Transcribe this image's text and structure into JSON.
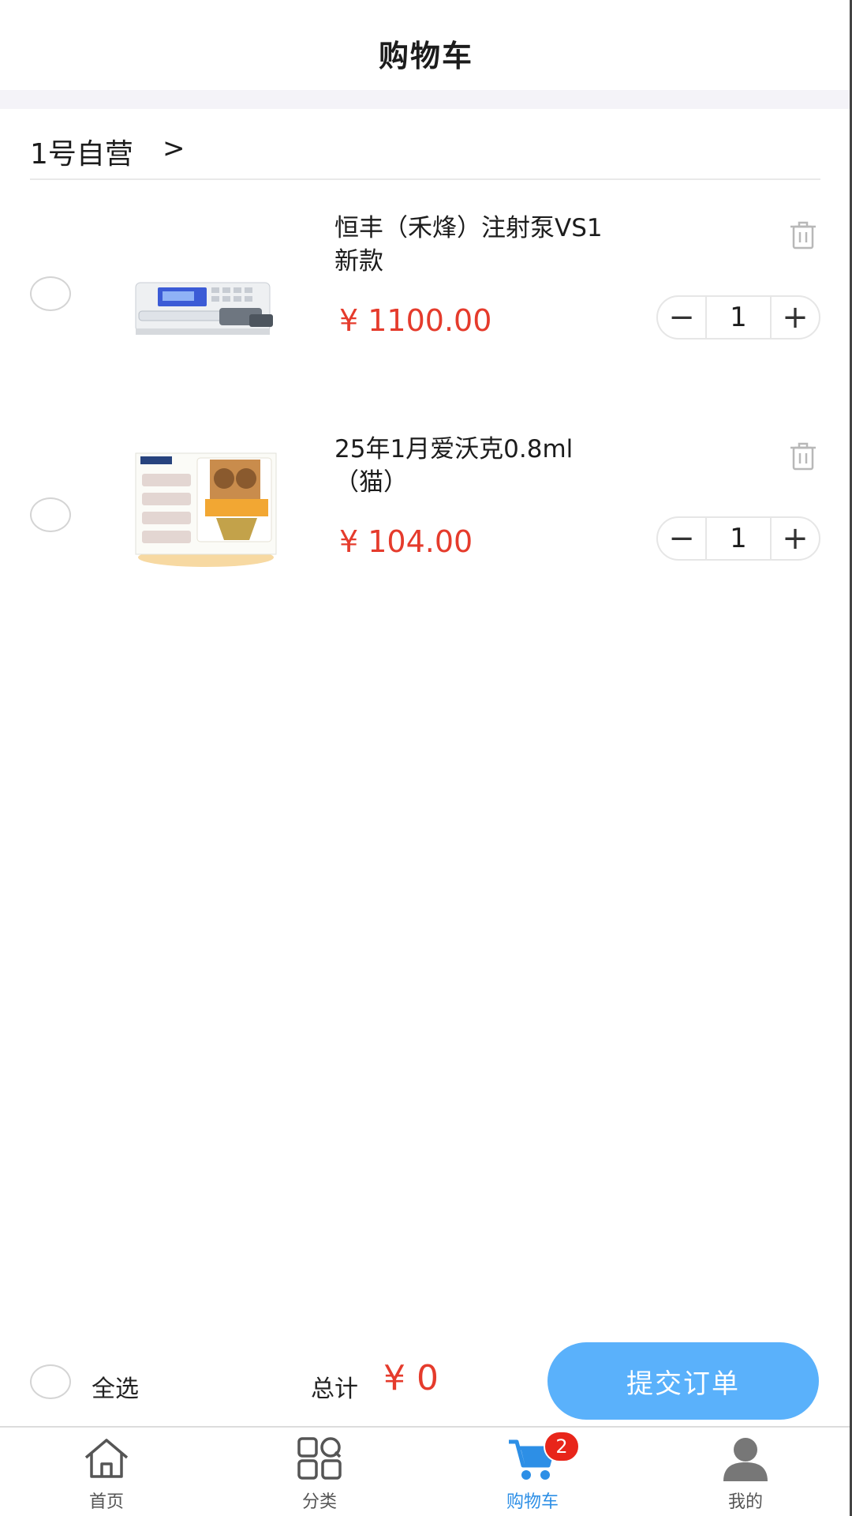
{
  "header": {
    "title": "购物车"
  },
  "store": {
    "name": "1号自营",
    "chevron": ">"
  },
  "cart_items": [
    {
      "name_line1": "恒丰（禾烽）注射泵VS1",
      "name_line2": "新款",
      "price": "¥ 1100.00",
      "quantity": "1",
      "image": "syringe-pump-image",
      "minus": "−",
      "plus": "+"
    },
    {
      "name_line1": "25年1月爱沃克0.8ml",
      "name_line2": "（猫）",
      "price": "¥ 104.00",
      "quantity": "1",
      "image": "cat-medicine-box-image",
      "minus": "−",
      "plus": "+"
    }
  ],
  "footer": {
    "select_all": "全选",
    "total_label": "总计",
    "total_value": "¥ 0",
    "submit": "提交订单"
  },
  "tabbar": {
    "tabs": [
      {
        "label": "首页",
        "icon": "home-icon"
      },
      {
        "label": "分类",
        "icon": "category-icon"
      },
      {
        "label": "购物车",
        "icon": "cart-icon",
        "badge": "2",
        "active": true
      },
      {
        "label": "我的",
        "icon": "user-icon"
      }
    ]
  },
  "colors": {
    "price": "#e53b2c",
    "submit_button": "#5ab1fb",
    "active_tab": "#2d8fe6",
    "badge": "#e8251a"
  }
}
